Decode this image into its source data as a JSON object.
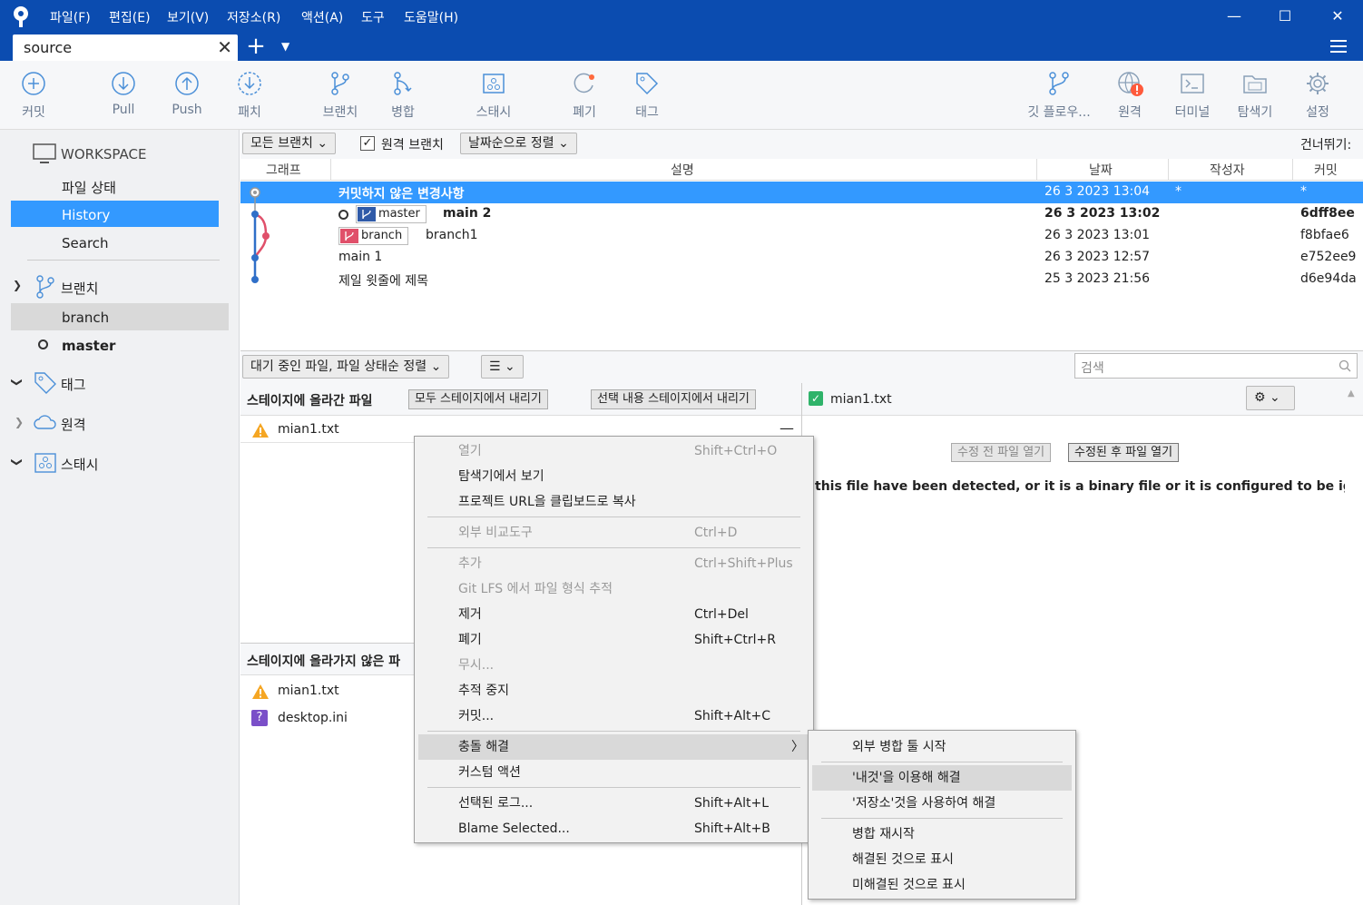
{
  "menubar": {
    "items": [
      "파일(F)",
      "편집(E)",
      "보기(V)",
      "저장소(R)",
      "액션(A)",
      "도구",
      "도움말(H)"
    ]
  },
  "tab": {
    "label": "source",
    "close": "✕"
  },
  "toolbar": {
    "commit": "커밋",
    "pull": "Pull",
    "push": "Push",
    "patch": "패치",
    "branch": "브랜치",
    "merge": "병합",
    "stash": "스태시",
    "discard": "폐기",
    "tag": "태그",
    "gitflow": "깃 플로우...",
    "remote": "원격",
    "terminal": "터미널",
    "explorer": "탐색기",
    "settings": "설정"
  },
  "sidebar": {
    "workspace": "WORKSPACE",
    "file_status": "파일 상태",
    "history": "History",
    "search": "Search",
    "branches": "브랜치",
    "branch_items": [
      "branch",
      "master"
    ],
    "tags": "태그",
    "remotes": "원격",
    "stashes": "스태시"
  },
  "history": {
    "filter_all": "모든 브랜치",
    "remote_branches": "원격 브랜치",
    "sort": "날짜순으로 정렬",
    "skip": "건너뛰기:",
    "columns": {
      "graph": "그래프",
      "description": "설명",
      "date": "날짜",
      "author": "작성자",
      "commit": "커밋"
    },
    "rows": [
      {
        "desc": "커밋하지 않은 변경사항",
        "date": "26 3 2023 13:04",
        "author": "*",
        "commit": "*"
      },
      {
        "badge": "master",
        "desc": "main 2",
        "date": "26 3 2023 13:02",
        "author": "",
        "commit": "6dff8ee"
      },
      {
        "badge": "branch",
        "desc": "branch1",
        "date": "26 3 2023 13:01",
        "author": "",
        "commit": "f8bfae6"
      },
      {
        "desc": "main 1",
        "date": "26 3 2023 12:57",
        "author": "",
        "commit": "e752ee9"
      },
      {
        "desc": "제일 윗줄에 제목",
        "date": "25 3 2023 21:56",
        "author": "",
        "commit": "d6e94da"
      }
    ]
  },
  "lower": {
    "pending_sort": "대기 중인 파일, 파일 상태순 정렬",
    "list_icon": "☰",
    "search_placeholder": "검색",
    "staged_title": "스테이지에 올라간 파일",
    "unstage_all": "모두 스테이지에서 내리기",
    "unstage_selected": "선택 내용 스테이지에서 내리기",
    "staged_files": [
      "mian1.txt"
    ],
    "unstaged_title": "스테이지에 올라가지 않은 파",
    "unstaged_files": [
      "mian1.txt",
      "desktop.ini"
    ]
  },
  "diff": {
    "file": "mian1.txt",
    "open_before": "수정 전 파일 열기",
    "open_after": "수정된 후 파일 열기",
    "message": "this file have been detected, or it is a binary file or it is configured to be ignored by the"
  },
  "context_menu": [
    {
      "label": "열기",
      "shortcut": "Shift+Ctrl+O",
      "disabled": true
    },
    {
      "label": "탐색기에서 보기",
      "shortcut": ""
    },
    {
      "label": "프로젝트 URL을 클립보드로 복사",
      "shortcut": ""
    },
    {
      "label": "외부 비교도구",
      "shortcut": "Ctrl+D",
      "disabled": true
    },
    {
      "label": "추가",
      "shortcut": "Ctrl+Shift+Plus",
      "disabled": true
    },
    {
      "label": "Git LFS 에서 파일 형식 추적",
      "shortcut": "",
      "disabled": true
    },
    {
      "label": "제거",
      "shortcut": "Ctrl+Del"
    },
    {
      "label": "폐기",
      "shortcut": "Shift+Ctrl+R"
    },
    {
      "label": "무시...",
      "shortcut": "",
      "disabled": true
    },
    {
      "label": "추적 중지",
      "shortcut": ""
    },
    {
      "label": "커밋...",
      "shortcut": "Shift+Alt+C"
    },
    {
      "label": "충돌 해결",
      "shortcut": ""
    },
    {
      "label": "커스텀 액션",
      "shortcut": ""
    },
    {
      "label": "선택된 로그...",
      "shortcut": "Shift+Alt+L"
    },
    {
      "label": "Blame Selected...",
      "shortcut": "Shift+Alt+B"
    }
  ],
  "submenu": [
    {
      "label": "외부 병합 툴 시작"
    },
    {
      "label": "'내것'을 이용해 해결"
    },
    {
      "label": "'저장소'것을 사용하여 해결"
    },
    {
      "label": "병합 재시작"
    },
    {
      "label": "해결된 것으로 표시"
    },
    {
      "label": "미해결된 것으로 표시"
    }
  ],
  "colors": {
    "accent": "#0b4cb0",
    "selected": "#3399ff",
    "branch_badge": "#e0506a",
    "master_badge": "#2f5aa8"
  }
}
